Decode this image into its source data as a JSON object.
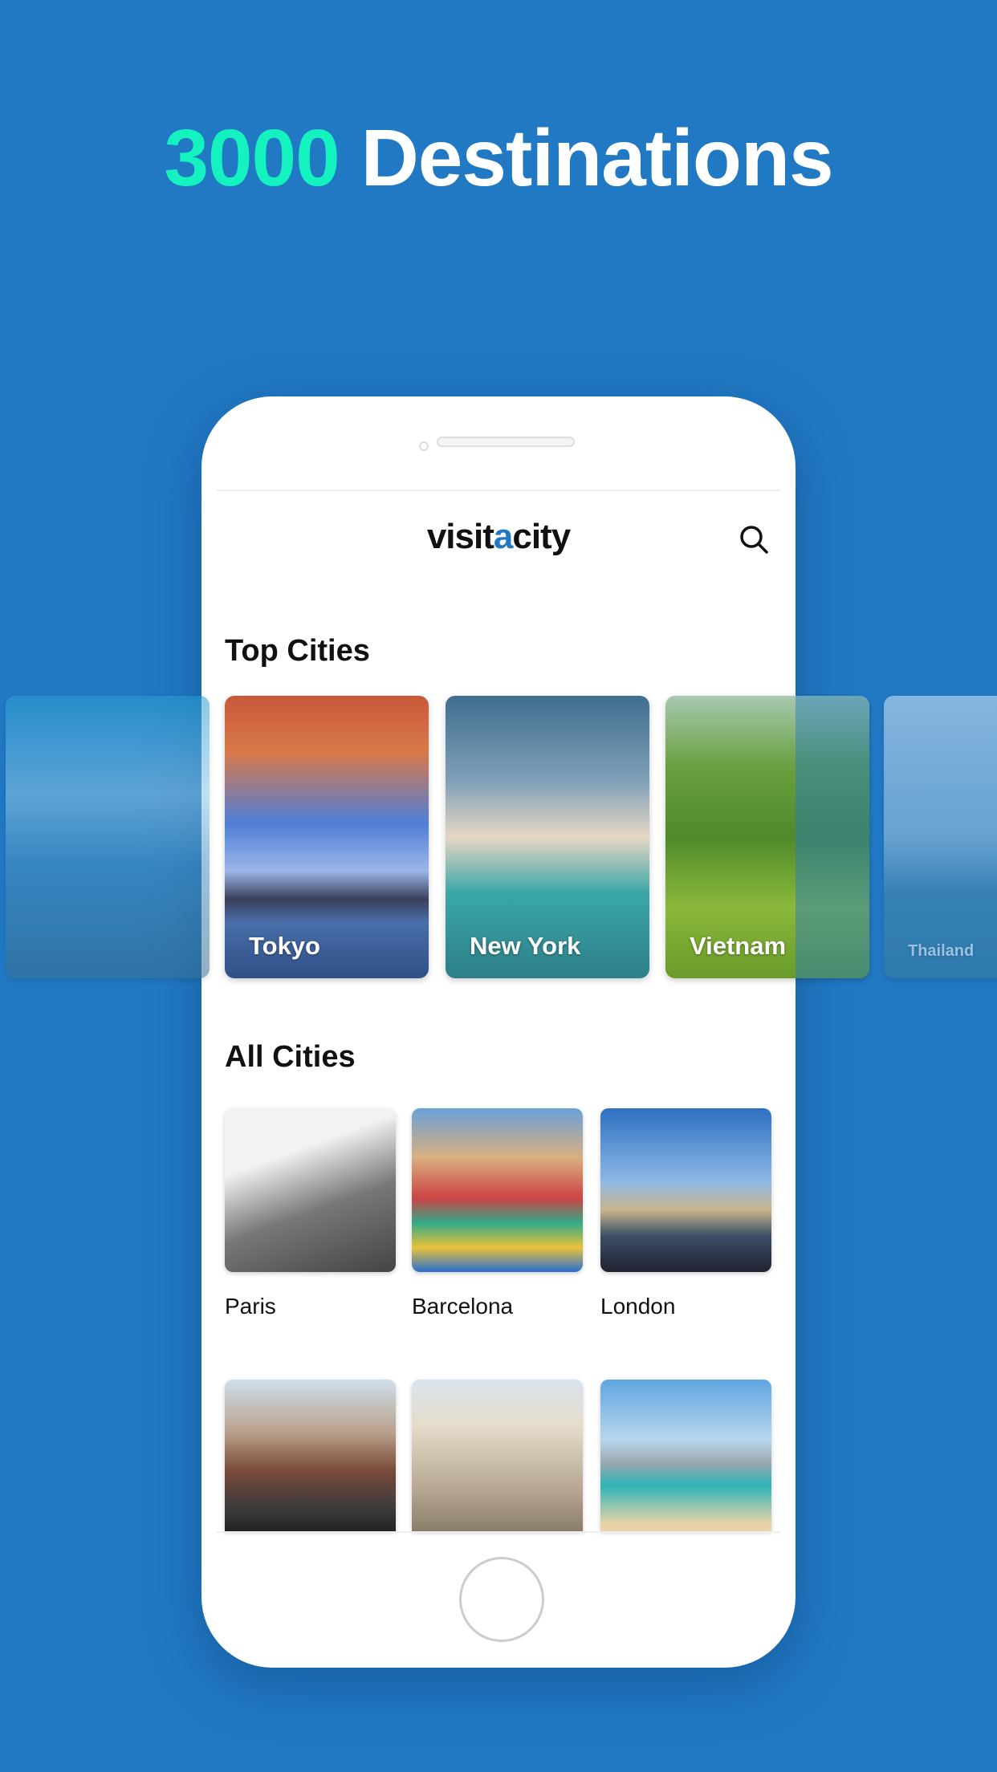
{
  "headline": {
    "accent": "3000",
    "rest": " Destinations"
  },
  "app": {
    "logo_pre": "visit",
    "logo_a": "a",
    "logo_post": "city"
  },
  "sections": {
    "top": "Top Cities",
    "all": "All Cities"
  },
  "top_cities": [
    "Tokyo",
    "New York",
    "Vietnam",
    "Thailand"
  ],
  "all_cities": [
    "Paris",
    "Barcelona",
    "London"
  ],
  "colors": {
    "background": "#2179c4",
    "accent": "#14f2c0"
  }
}
